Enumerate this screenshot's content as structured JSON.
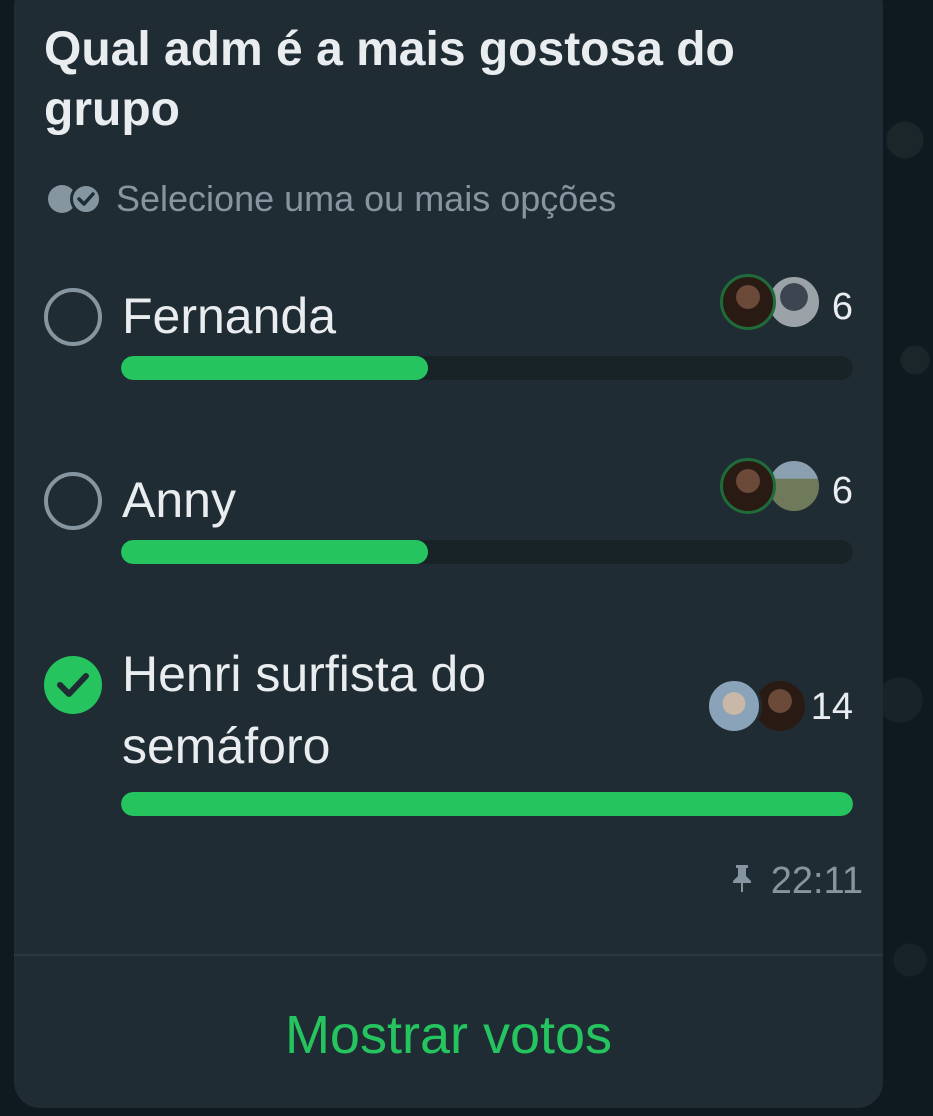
{
  "poll": {
    "question": "Qual adm é a mais gostosa do grupo",
    "hint": "Selecione uma ou mais opções",
    "options": [
      {
        "label": "Fernanda",
        "votes": "6",
        "fill_fraction": 0.42,
        "selected": false
      },
      {
        "label": "Anny",
        "votes": "6",
        "fill_fraction": 0.42,
        "selected": false
      },
      {
        "label": "Henri surfista do semáforo",
        "votes": "14",
        "fill_fraction": 1.0,
        "selected": true
      }
    ],
    "time": "22:11",
    "show_votes_label": "Mostrar votos"
  },
  "colors": {
    "bubble": "#202c33",
    "accent_green": "#25c45f",
    "muted": "#8696a0",
    "text": "#e9edef"
  },
  "icons": [
    "double-check-icon",
    "radio-empty-icon",
    "radio-checked-icon",
    "pin-icon"
  ]
}
